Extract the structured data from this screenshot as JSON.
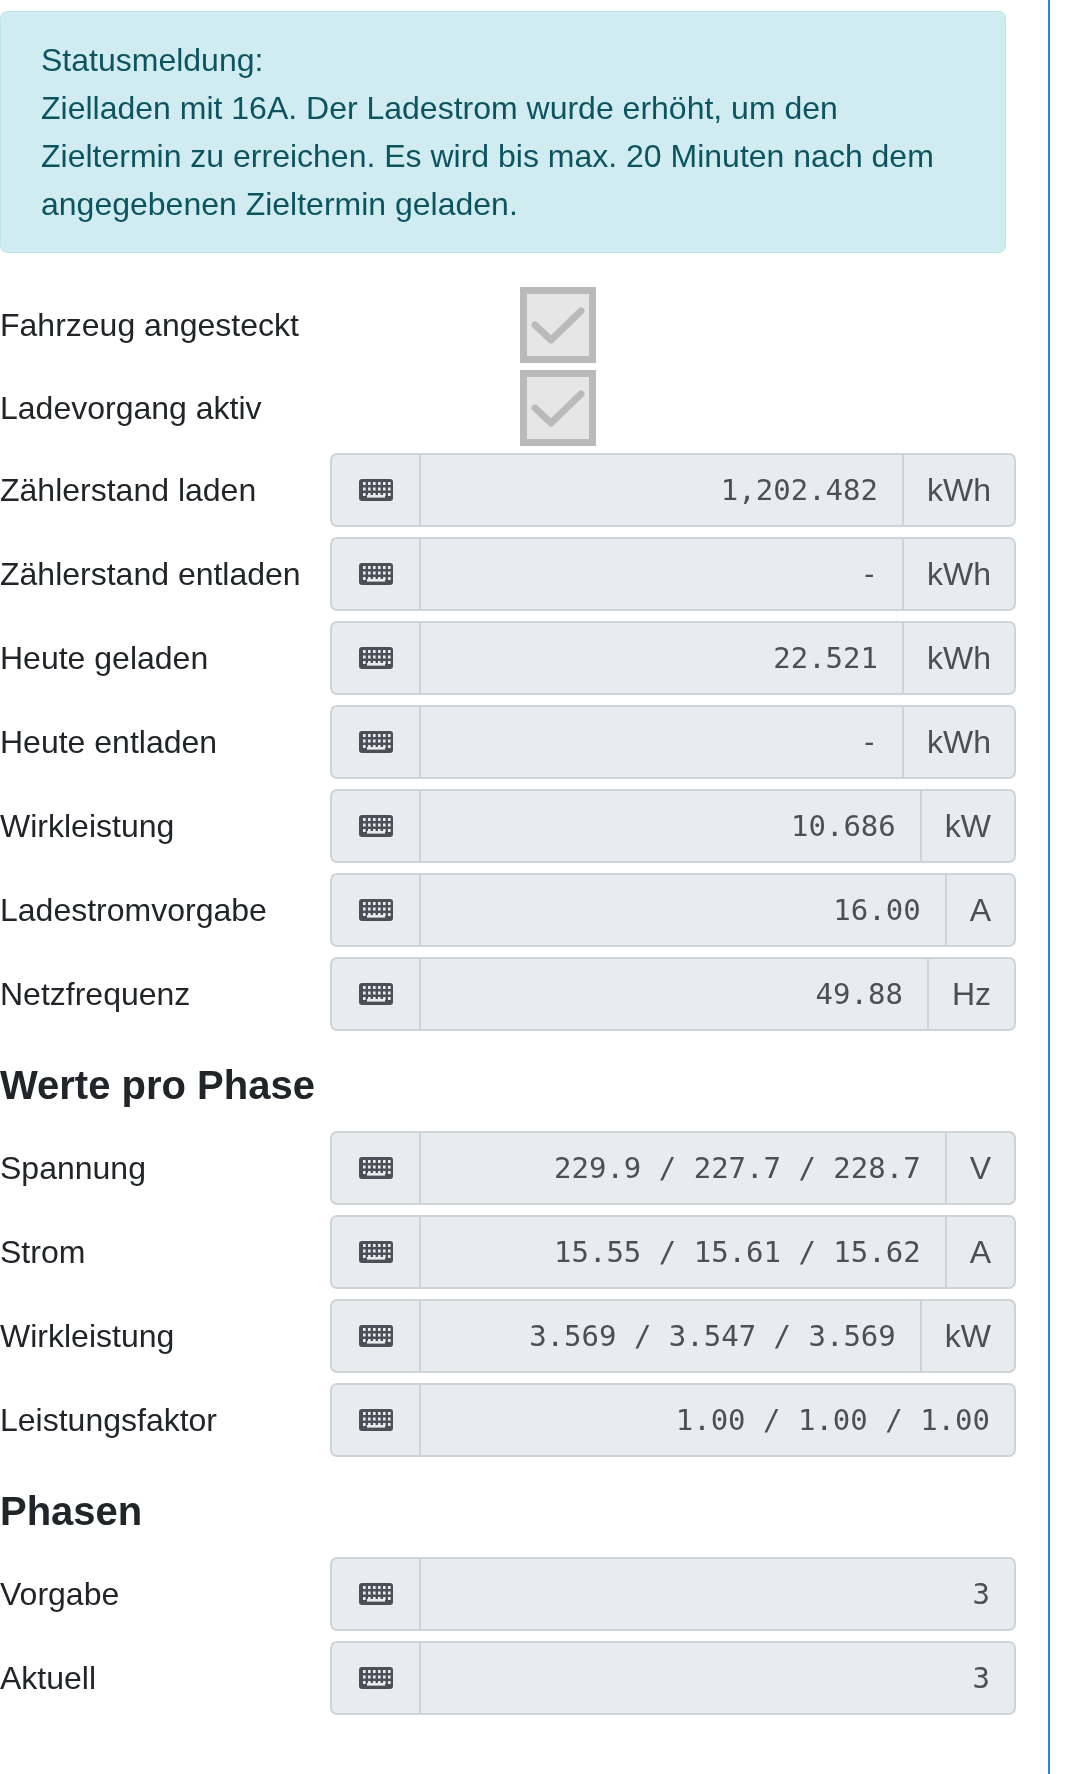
{
  "status_alert": {
    "title": "Statusmeldung:",
    "message": "Zielladen mit 16A. Der Ladestrom wurde erhöht, um den Zieltermin zu erreichen. Es wird bis max. 20 Minuten nach dem angegebenen Zieltermin geladen."
  },
  "indicators": [
    {
      "label": "Fahrzeug angesteckt",
      "checked": true,
      "disabled": true
    },
    {
      "label": "Ladevorgang aktiv",
      "checked": true,
      "disabled": true
    }
  ],
  "readings": [
    {
      "label": "Zählerstand laden",
      "value": "1,202.482",
      "unit": "kWh"
    },
    {
      "label": "Zählerstand entladen",
      "value": "-",
      "unit": "kWh"
    },
    {
      "label": "Heute geladen",
      "value": "22.521",
      "unit": "kWh"
    },
    {
      "label": "Heute entladen",
      "value": "-",
      "unit": "kWh"
    },
    {
      "label": "Wirkleistung",
      "value": "10.686",
      "unit": "kW"
    },
    {
      "label": "Ladestromvorgabe",
      "value": "16.00",
      "unit": "A"
    },
    {
      "label": "Netzfrequenz",
      "value": "49.88",
      "unit": "Hz"
    }
  ],
  "sections": [
    {
      "heading": "Werte pro Phase",
      "readings": [
        {
          "label": "Spannung",
          "value": "229.9 / 227.7 / 228.7",
          "unit": "V"
        },
        {
          "label": "Strom",
          "value": "15.55 / 15.61 / 15.62",
          "unit": "A"
        },
        {
          "label": "Wirkleistung",
          "value": "3.569 / 3.547 / 3.569",
          "unit": "kW"
        },
        {
          "label": "Leistungsfaktor",
          "value": "1.00 / 1.00 / 1.00"
        }
      ]
    },
    {
      "heading": "Phasen",
      "readings": [
        {
          "label": "Vorgabe",
          "value": "3"
        },
        {
          "label": "Aktuell",
          "value": "3"
        }
      ]
    }
  ]
}
